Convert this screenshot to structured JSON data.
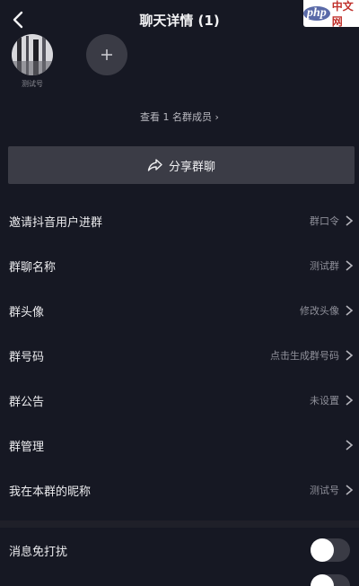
{
  "header": {
    "title": "聊天详情 (1)",
    "watermark_logo": "php",
    "watermark_text": "中文网"
  },
  "members": {
    "items": [
      {
        "name": "测试号",
        "avatar_icon": "user-avatar"
      }
    ],
    "add_icon": "plus-icon",
    "view_all_label": "查看 1 名群成员 ›"
  },
  "share_button": {
    "label": "分享群聊",
    "icon": "share-icon"
  },
  "settings": [
    {
      "label": "邀请抖音用户进群",
      "value": "群口令"
    },
    {
      "label": "群聊名称",
      "value": "测试群"
    },
    {
      "label": "群头像",
      "value": "修改头像"
    },
    {
      "label": "群号码",
      "value": "点击生成群号码"
    },
    {
      "label": "群公告",
      "value": "未设置"
    },
    {
      "label": "群管理",
      "value": ""
    },
    {
      "label": "我在本群的昵称",
      "value": "测试号"
    }
  ],
  "toggles": [
    {
      "label": "消息免打扰",
      "on": false
    }
  ],
  "colors": {
    "background": "#161823",
    "button": "#3b3c46",
    "text": "#ececef",
    "muted": "#8f909a"
  }
}
